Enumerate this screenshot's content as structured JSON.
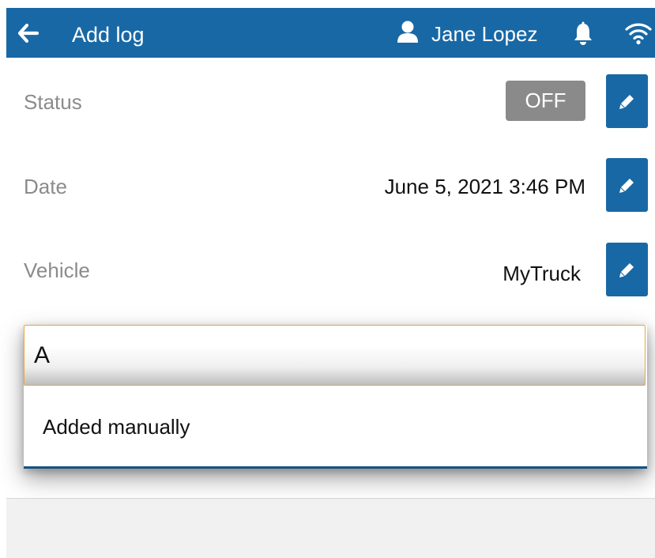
{
  "header": {
    "title": "Add log",
    "user_name": "Jane Lopez",
    "back_icon": "arrow-left-icon",
    "user_icon": "user-icon",
    "bell_icon": "bell-icon",
    "wifi_icon": "wifi-icon"
  },
  "rows": {
    "status": {
      "label": "Status",
      "value": "OFF"
    },
    "date": {
      "label": "Date",
      "value": "June 5, 2021 3:46 PM"
    },
    "vehicle": {
      "label": "Vehicle",
      "value": "MyTruck"
    }
  },
  "annotation": {
    "input_value": "A",
    "suggestions": [
      "Added manually"
    ]
  },
  "colors": {
    "primary": "#1868a5",
    "status_off": "#8a8a8a",
    "input_border": "#e4a946",
    "label_gray": "#8b8b8b"
  }
}
